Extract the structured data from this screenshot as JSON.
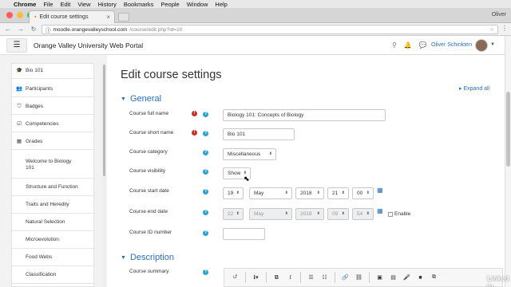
{
  "mac_menu": {
    "app": "Chrome",
    "items": [
      "File",
      "Edit",
      "View",
      "History",
      "Bookmarks",
      "People",
      "Window",
      "Help"
    ],
    "right_user": "Oliver"
  },
  "browser": {
    "tab_title": "Edit course settings",
    "url_host": "moodle.orangevalleyschool.com",
    "url_path": "/course/edit.php?id=10",
    "traffic_colors": [
      "#fc5b57",
      "#fdbc40",
      "#34c84a"
    ]
  },
  "navbar": {
    "site_name": "Orange Valley University Web Portal",
    "user_name": "Oliver Schinkten",
    "menu_glyph": "☰"
  },
  "sidebar": {
    "items": [
      {
        "icon": "🎓",
        "label": "Bio 101",
        "icon_name": "graduation-cap-icon"
      },
      {
        "icon": "👥",
        "label": "Participants",
        "icon_name": "users-icon"
      },
      {
        "icon": "⛉",
        "label": "Badges",
        "icon_name": "shield-icon"
      },
      {
        "icon": "☑",
        "label": "Competencies",
        "icon_name": "checkbox-icon"
      },
      {
        "icon": "▦",
        "label": "Grades",
        "icon_name": "table-icon"
      },
      {
        "icon": "▢",
        "label": "Welcome to Biology 101",
        "icon_name": "folder-icon"
      },
      {
        "icon": "▢",
        "label": "Structure and Function",
        "icon_name": "folder-icon"
      },
      {
        "icon": "▢",
        "label": "Traits and Heredity",
        "icon_name": "folder-icon"
      },
      {
        "icon": "▢",
        "label": "Natural Selection",
        "icon_name": "folder-icon"
      },
      {
        "icon": "▢",
        "label": "Microevolution",
        "icon_name": "folder-icon"
      },
      {
        "icon": "▢",
        "label": "Food Webs",
        "icon_name": "folder-icon"
      },
      {
        "icon": "▢",
        "label": "Classification",
        "icon_name": "folder-icon"
      }
    ]
  },
  "main": {
    "title": "Edit course settings",
    "expand_all": "Expand all",
    "general_section": "General",
    "description_section": "Description",
    "fields": {
      "full_name": {
        "label": "Course full name",
        "value": "Biology 101: Concepts of Biology"
      },
      "short_name": {
        "label": "Course short name",
        "value": "Bio 101"
      },
      "category": {
        "label": "Course category",
        "value": "Miscellaneous"
      },
      "visibility": {
        "label": "Course visibility",
        "value": "Show"
      },
      "start_date": {
        "label": "Course start date",
        "day": "19",
        "month": "May",
        "year": "2018",
        "hour": "21",
        "minute": "00"
      },
      "end_date": {
        "label": "Course end date",
        "day": "22",
        "month": "May",
        "year": "2018",
        "hour": "09",
        "minute": "54",
        "enable_label": "Enable"
      },
      "id_number": {
        "label": "Course ID number",
        "value": ""
      },
      "summary": {
        "label": "Course summary"
      }
    }
  },
  "watermark": "Linked in"
}
